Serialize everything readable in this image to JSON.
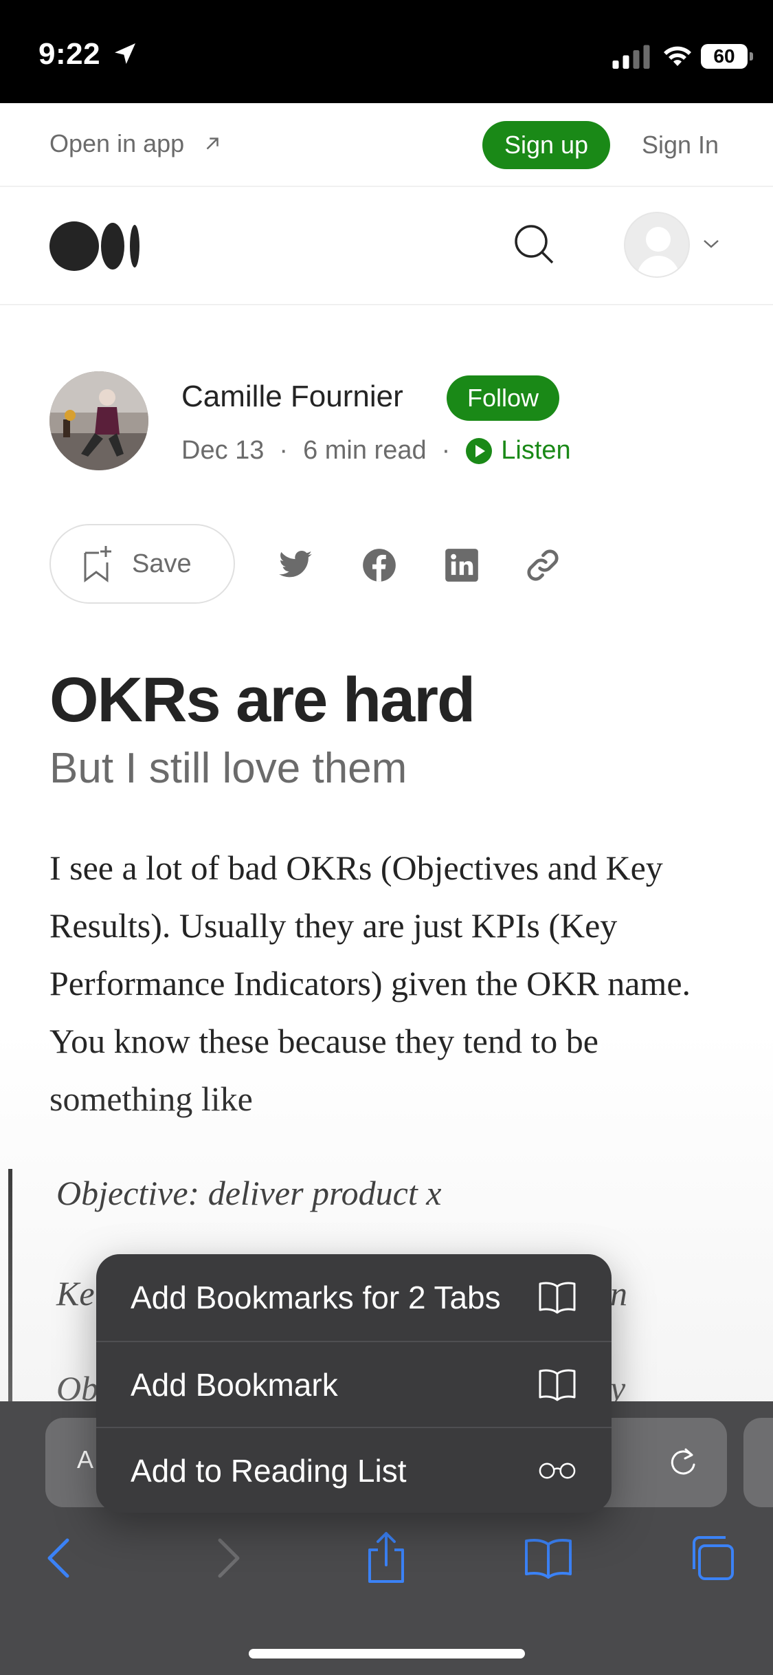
{
  "status_bar": {
    "time": "9:22",
    "battery": "60"
  },
  "top_banner": {
    "open_in_app": "Open in app",
    "sign_up": "Sign up",
    "sign_in": "Sign In"
  },
  "article": {
    "author": "Camille Fournier",
    "follow": "Follow",
    "date": "Dec 13",
    "read_time": "6 min read",
    "listen": "Listen",
    "save": "Save",
    "title": "OKRs are hard",
    "subtitle": "But I still love them",
    "body": "I see a lot of bad OKRs (Objectives and Key Results). Usually they are just KPIs (Key Performance Indicators) given the OKR name. You know these because they tend to be something like",
    "quote_lines": [
      "Objective: deliver product x",
      "Ke",
      "n",
      "Ob",
      "y"
    ]
  },
  "browser": {
    "address_partial": "A"
  },
  "context_menu": {
    "items": [
      {
        "label": "Add Bookmarks for 2 Tabs",
        "icon": "book-icon"
      },
      {
        "label": "Add Bookmark",
        "icon": "book-icon"
      },
      {
        "label": "Add to Reading List",
        "icon": "glasses-icon"
      }
    ]
  },
  "colors": {
    "brand_green": "#1a8917",
    "toolbar_bg": "#4a4a4c",
    "menu_bg": "#3b3b3d",
    "ios_blue": "#3b82f6"
  }
}
